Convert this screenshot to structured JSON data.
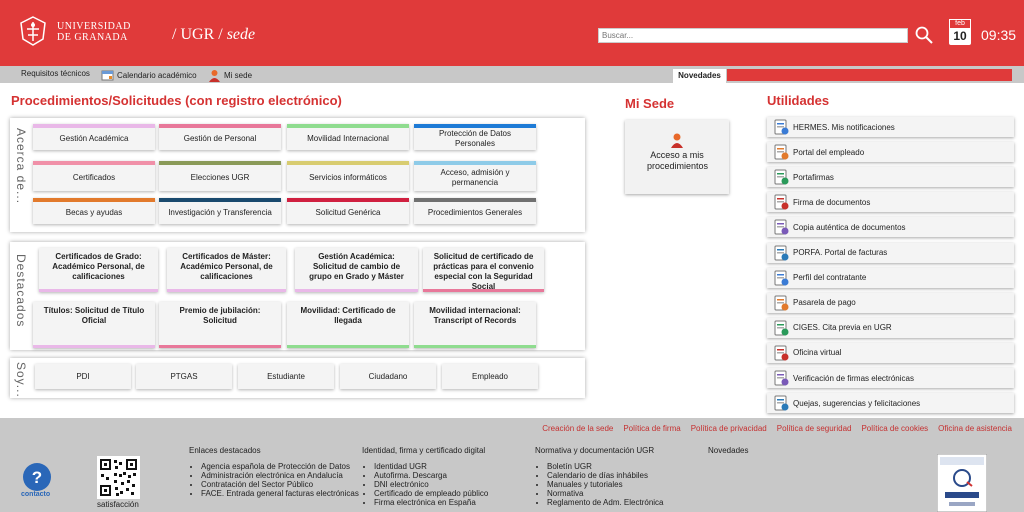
{
  "header": {
    "uni_line1": "UNIVERSIDAD",
    "uni_line2": "DE GRANADA",
    "brand_ugr": "UGR",
    "brand_sede": "sede",
    "search_placeholder": "Buscar...",
    "cal_month": "feb",
    "cal_day": "10",
    "time": "09:35"
  },
  "subnav": {
    "items": [
      "Requisitos técnicos",
      "Calendario académico",
      "Mi sede"
    ],
    "novedades": "Novedades"
  },
  "procs": {
    "title": "Procedimientos/Solicitudes (con registro electrónico)",
    "acerca_label": "Acerca de...",
    "acerca": [
      {
        "label": "Gestión Académica",
        "color": "#e9b8e8"
      },
      {
        "label": "Gestión de Personal",
        "color": "#e8789a"
      },
      {
        "label": "Movilidad Internacional",
        "color": "#8fdc8f"
      },
      {
        "label": "Protección de Datos Personales",
        "color": "#1e7bd6"
      },
      {
        "label": "Certificados",
        "color": "#f090a8"
      },
      {
        "label": "Elecciones UGR",
        "color": "#8a9a58"
      },
      {
        "label": "Servicios informáticos",
        "color": "#d8cc70"
      },
      {
        "label": "Acceso, admisión y permanencia",
        "color": "#8ecbe8"
      },
      {
        "label": "Becas y ayudas",
        "color": "#e27a2c"
      },
      {
        "label": "Investigación y Transferencia",
        "color": "#1a4a6e"
      },
      {
        "label": "Solicitud Genérica",
        "color": "#d02040"
      },
      {
        "label": "Procedimientos Generales",
        "color": "#707070"
      }
    ],
    "destacados_label": "Destacados",
    "destacados": [
      {
        "label": "Certificados de Grado: Académico Personal, de calificaciones",
        "color": "#e9b8e8"
      },
      {
        "label": "Certificados de Máster: Académico Personal, de calificaciones",
        "color": "#e9b8e8"
      },
      {
        "label": "Gestión Académica: Solicitud de cambio de grupo en Grado y Máster",
        "color": "#e9b8e8"
      },
      {
        "label": "Solicitud de certificado de prácticas para el convenio especial con la Seguridad Social",
        "color": "#e8789a"
      },
      {
        "label": "Títulos: Solicitud de Título Oficial",
        "color": "#e9b8e8"
      },
      {
        "label": "Premio de jubilación: Solicitud",
        "color": "#e8789a"
      },
      {
        "label": "Movilidad: Certificado de llegada",
        "color": "#8fdc8f"
      },
      {
        "label": "Movilidad internacional: Transcript of Records",
        "color": "#8fdc8f"
      }
    ],
    "soy_label": "Soy...",
    "soy": [
      "PDI",
      "PTGAS",
      "Estudiante",
      "Ciudadano",
      "Empleado"
    ]
  },
  "misede": {
    "title": "Mi Sede",
    "card": "Acceso a mis procedimientos"
  },
  "utilidades": {
    "title": "Utilidades",
    "items": [
      {
        "label": "HERMES. Mis notificaciones",
        "icon": "mail-check-icon"
      },
      {
        "label": "Portal del empleado",
        "icon": "employees-icon"
      },
      {
        "label": "Portafirmas",
        "icon": "signature-icon"
      },
      {
        "label": "Firma de documentos",
        "icon": "document-sign-icon"
      },
      {
        "label": "Copia auténtica de documentos",
        "icon": "document-copy-icon"
      },
      {
        "label": "PORFA. Portal de facturas",
        "icon": "invoice-icon"
      },
      {
        "label": "Perfil del contratante",
        "icon": "contract-icon"
      },
      {
        "label": "Pasarela de pago",
        "icon": "payment-icon"
      },
      {
        "label": "CIGES. Cita previa en UGR",
        "icon": "appointment-icon"
      },
      {
        "label": "Oficina virtual",
        "icon": "lock-icon"
      },
      {
        "label": "Verificación de firmas electrónicas",
        "icon": "verify-icon"
      },
      {
        "label": "Quejas, sugerencias y felicitaciones",
        "icon": "complaints-icon"
      }
    ]
  },
  "footer": {
    "links": [
      "Creación de la sede",
      "Política de firma",
      "Política de privacidad",
      "Política de seguridad",
      "Política de cookies",
      "Oficina de asistencia"
    ],
    "contacto": "contacto",
    "satisfaccion": "satisfacción",
    "cols": [
      {
        "title": "Enlaces destacados",
        "items": [
          "Agencia española de Protección de Datos",
          "Administración electrónica en Andalucía",
          "Contratación del Sector Público",
          "FACE. Entrada general facturas electrónicas"
        ]
      },
      {
        "title": "Identidad, firma y certificado digital",
        "items": [
          "Identidad UGR",
          "Autofirma. Descarga",
          "DNI electrónico",
          "Certificado de empleado público",
          "Firma electrónica en España"
        ]
      },
      {
        "title": "Normativa y documentación UGR",
        "items": [
          "Boletín UGR",
          "Calendario de días inhábiles",
          "Manuales y tutoriales",
          "Normativa",
          "Reglamento de Adm. Electrónica"
        ]
      },
      {
        "title": "Novedades",
        "items": []
      }
    ]
  }
}
